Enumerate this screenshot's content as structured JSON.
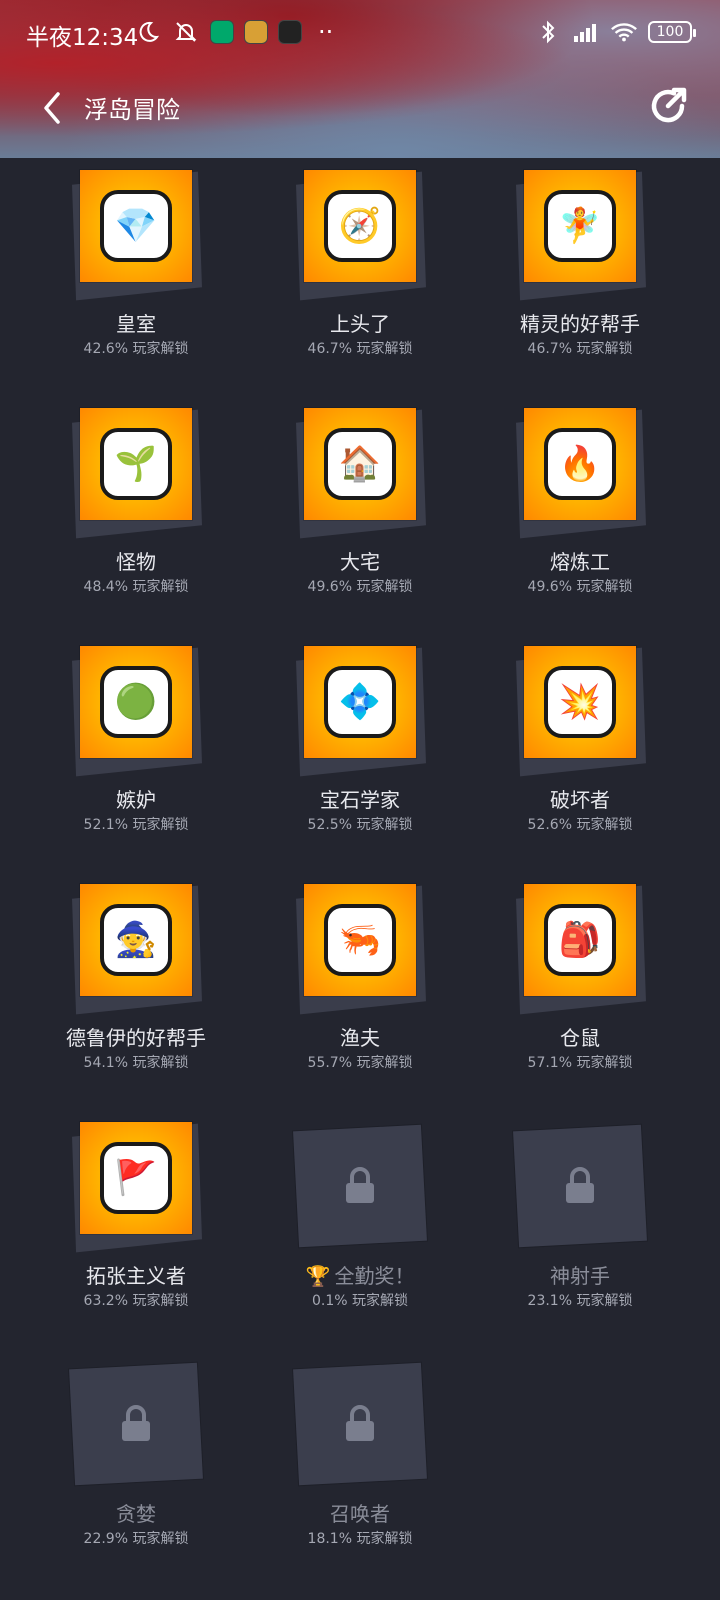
{
  "status": {
    "time": "半夜12:34",
    "battery": "100"
  },
  "nav": {
    "title": "浮岛冒险"
  },
  "unlock_suffix": "玩家解锁",
  "achievements": [
    {
      "title": "皇室",
      "rate": "42.6% 玩家解锁",
      "locked": false,
      "icon": "💎"
    },
    {
      "title": "上头了",
      "rate": "46.7% 玩家解锁",
      "locked": false,
      "icon": "🧭"
    },
    {
      "title": "精灵的好帮手",
      "rate": "46.7% 玩家解锁",
      "locked": false,
      "icon": "🧚"
    },
    {
      "title": "怪物",
      "rate": "48.4% 玩家解锁",
      "locked": false,
      "icon": "🌱"
    },
    {
      "title": "大宅",
      "rate": "49.6% 玩家解锁",
      "locked": false,
      "icon": "🏠"
    },
    {
      "title": "熔炼工",
      "rate": "49.6% 玩家解锁",
      "locked": false,
      "icon": "🔥"
    },
    {
      "title": "嫉妒",
      "rate": "52.1% 玩家解锁",
      "locked": false,
      "icon": "🟢"
    },
    {
      "title": "宝石学家",
      "rate": "52.5% 玩家解锁",
      "locked": false,
      "icon": "💠"
    },
    {
      "title": "破坏者",
      "rate": "52.6% 玩家解锁",
      "locked": false,
      "icon": "💥"
    },
    {
      "title": "德鲁伊的好帮手",
      "rate": "54.1% 玩家解锁",
      "locked": false,
      "icon": "🧙"
    },
    {
      "title": "渔夫",
      "rate": "55.7% 玩家解锁",
      "locked": false,
      "icon": "🦐"
    },
    {
      "title": "仓鼠",
      "rate": "57.1% 玩家解锁",
      "locked": false,
      "icon": "🎒"
    },
    {
      "title": "拓张主义者",
      "rate": "63.2% 玩家解锁",
      "locked": false,
      "icon": "🚩"
    },
    {
      "title": "全勤奖！",
      "rate": "0.1% 玩家解锁",
      "locked": true,
      "trophy": true
    },
    {
      "title": "神射手",
      "rate": "23.1% 玩家解锁",
      "locked": true
    },
    {
      "title": "贪婪",
      "rate": "22.9% 玩家解锁",
      "locked": true
    },
    {
      "title": "召唤者",
      "rate": "18.1% 玩家解锁",
      "locked": true
    }
  ]
}
